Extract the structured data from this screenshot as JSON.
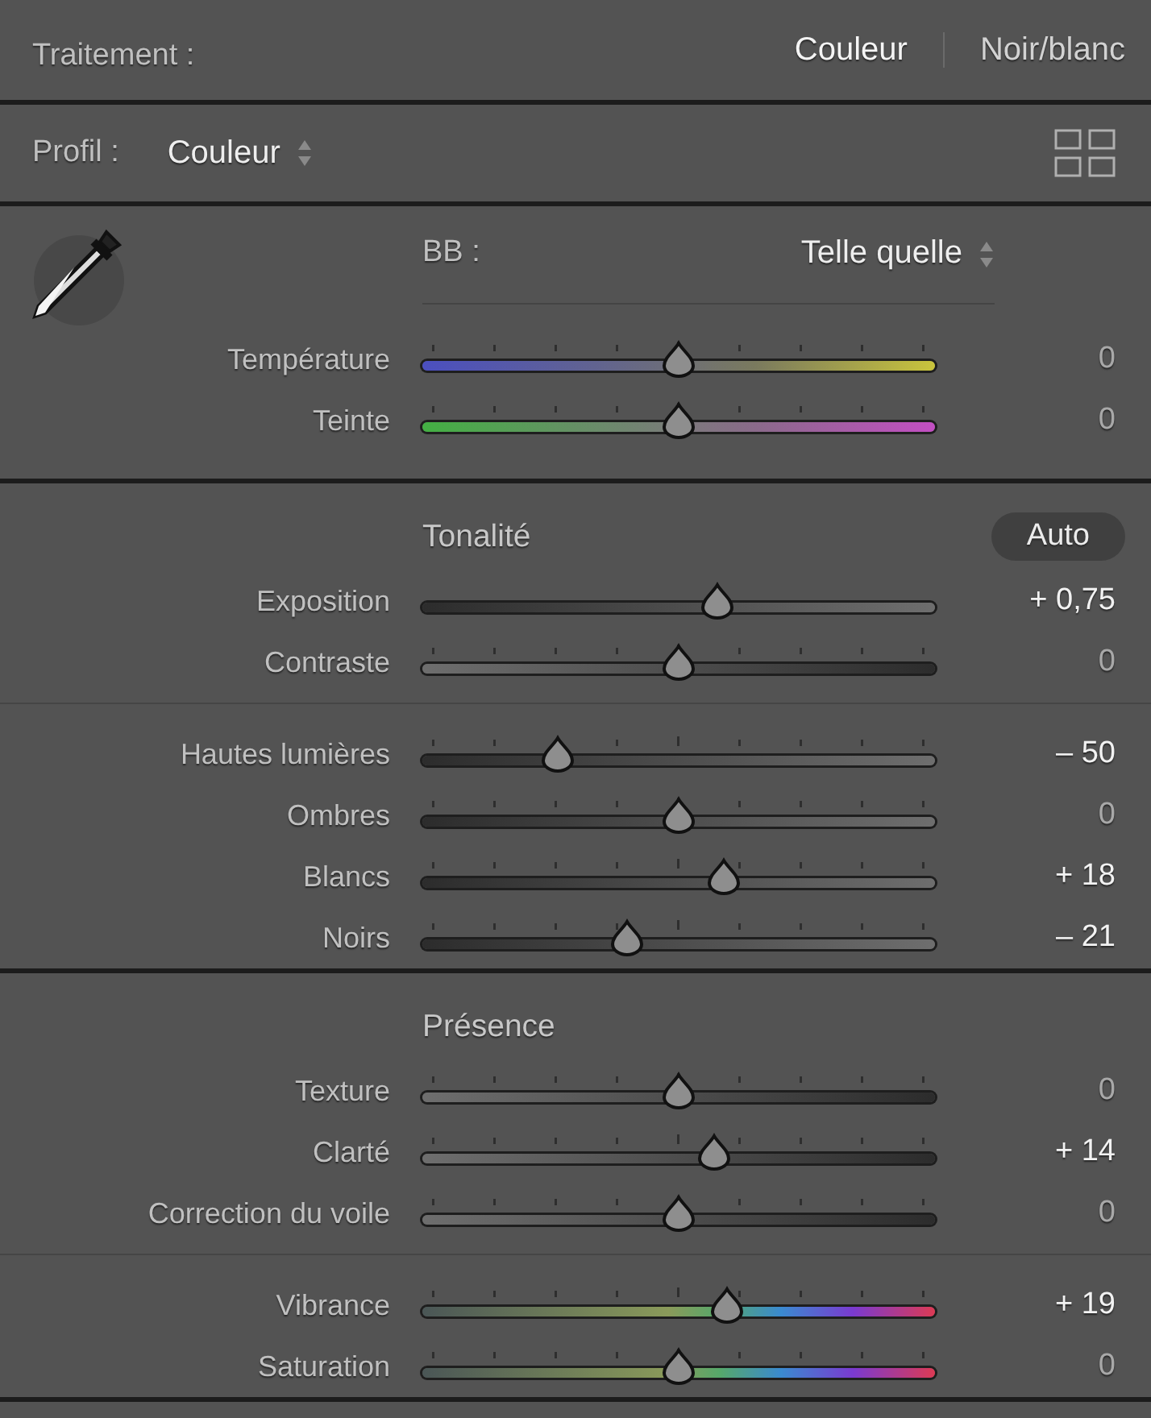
{
  "treatment": {
    "label": "Traitement :",
    "options": [
      {
        "label": "Couleur",
        "selected": true
      },
      {
        "label": "Noir/blanc",
        "selected": false
      }
    ]
  },
  "profile": {
    "label": "Profil :",
    "value": "Couleur"
  },
  "white_balance": {
    "label": "BB :",
    "value": "Telle quelle",
    "sliders": [
      {
        "label": "Température",
        "value": "0",
        "modified": false,
        "level": 0.5,
        "kind": "temperature",
        "ticks": true
      },
      {
        "label": "Teinte",
        "value": "0",
        "modified": false,
        "level": 0.5,
        "kind": "tint",
        "ticks": true
      }
    ]
  },
  "tone": {
    "title": "Tonalité",
    "auto": "Auto",
    "groups": [
      [
        {
          "label": "Exposition",
          "value": "+ 0,75",
          "modified": true,
          "level": 0.575,
          "kind": "rising",
          "ticks": false
        },
        {
          "label": "Contraste",
          "value": "0",
          "modified": false,
          "level": 0.5,
          "kind": "falling",
          "ticks": true
        }
      ],
      [
        {
          "label": "Hautes lumières",
          "value": "– 50",
          "modified": true,
          "level": 0.265,
          "kind": "rising",
          "ticks": true
        },
        {
          "label": "Ombres",
          "value": "0",
          "modified": false,
          "level": 0.5,
          "kind": "rising",
          "ticks": true
        },
        {
          "label": "Blancs",
          "value": "+ 18",
          "modified": true,
          "level": 0.587,
          "kind": "rising",
          "ticks": true
        },
        {
          "label": "Noirs",
          "value": "– 21",
          "modified": true,
          "level": 0.4,
          "kind": "rising",
          "ticks": true
        }
      ]
    ]
  },
  "presence": {
    "title": "Présence",
    "groups": [
      [
        {
          "label": "Texture",
          "value": "0",
          "modified": false,
          "level": 0.5,
          "kind": "falling",
          "ticks": true
        },
        {
          "label": "Clarté",
          "value": "+ 14",
          "modified": true,
          "level": 0.568,
          "kind": "falling",
          "ticks": true
        },
        {
          "label": "Correction du voile",
          "value": "0",
          "modified": false,
          "level": 0.5,
          "kind": "falling",
          "ticks": true
        }
      ],
      [
        {
          "label": "Vibrance",
          "value": "+ 19",
          "modified": true,
          "level": 0.595,
          "kind": "vibrance",
          "ticks": true
        },
        {
          "label": "Saturation",
          "value": "0",
          "modified": false,
          "level": 0.5,
          "kind": "vibrance",
          "ticks": true
        }
      ]
    ]
  }
}
